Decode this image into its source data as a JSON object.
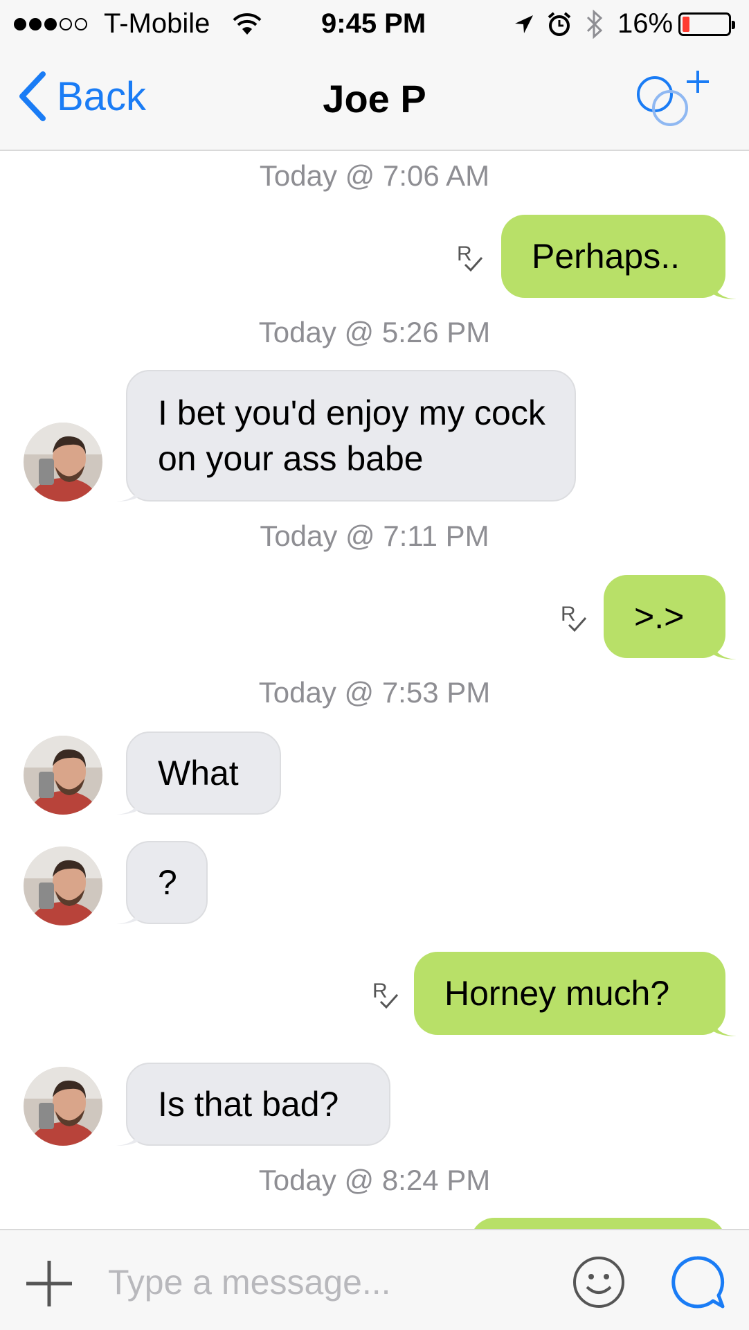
{
  "status_bar": {
    "carrier": "T-Mobile",
    "time": "9:45 PM",
    "battery": "16%",
    "icons": [
      "signal-dots-icon",
      "wifi-icon",
      "location-arrow-icon",
      "alarm-icon",
      "bluetooth-icon",
      "battery-icon"
    ]
  },
  "nav": {
    "back_label": "Back",
    "title": "Joe P",
    "add_icon": "add-people-icon"
  },
  "messages": [
    {
      "type": "timestamp",
      "text": "Today @ 7:06 AM"
    },
    {
      "type": "outgoing",
      "text": "Perhaps..",
      "receipt": "read-receipt-icon"
    },
    {
      "type": "timestamp",
      "text": "Today @ 5:26 PM"
    },
    {
      "type": "incoming",
      "text": "I bet you'd enjoy my cock on your ass babe"
    },
    {
      "type": "timestamp",
      "text": "Today @ 7:11 PM"
    },
    {
      "type": "outgoing",
      "text": ">.>",
      "receipt": "read-receipt-icon"
    },
    {
      "type": "timestamp",
      "text": "Today @ 7:53 PM"
    },
    {
      "type": "incoming",
      "text": "What"
    },
    {
      "type": "incoming",
      "text": "?"
    },
    {
      "type": "outgoing",
      "text": "Horney much?",
      "receipt": "read-receipt-icon"
    },
    {
      "type": "incoming",
      "text": "Is that bad?"
    },
    {
      "type": "timestamp",
      "text": "Today @ 8:24 PM"
    }
  ],
  "input_bar": {
    "placeholder": "Type a message...",
    "icons": [
      "plus-icon",
      "emoji-icon",
      "send-icon"
    ]
  },
  "colors": {
    "accent": "#1a7cf5",
    "outgoing_bubble": "#b8e068",
    "incoming_bubble": "#e9eaee",
    "timestamp_text": "#8e8e93"
  }
}
